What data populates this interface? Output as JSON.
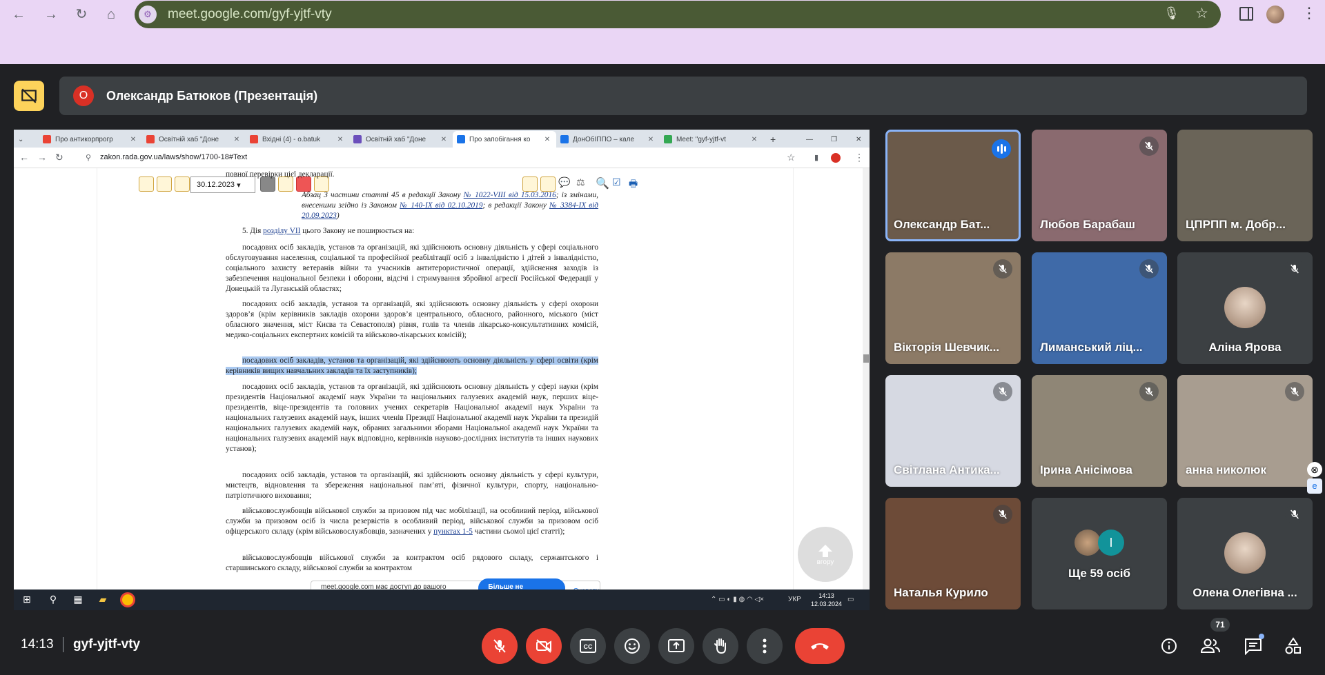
{
  "browser": {
    "url": "meet.google.com/gyf-yjtf-vty"
  },
  "meet": {
    "presenter_initial": "О",
    "presenter_title": "Олександр Батюков (Презентація)",
    "meeting_time": "14:13",
    "meeting_code": "gyf-yjtf-vty",
    "participant_count": "71"
  },
  "shared": {
    "tabs": [
      {
        "label": "Про антикорпрогр",
        "color": "#ea4335"
      },
      {
        "label": "Освітній хаб \"Доне",
        "color": "#ea4335"
      },
      {
        "label": "Вхідні (4) - o.batuk",
        "color": "#ea4335"
      },
      {
        "label": "Освітній хаб \"Доне",
        "color": "#6b4fbb"
      },
      {
        "label": "Про запобігання ко",
        "color": "#1a73e8"
      },
      {
        "label": "ДонОбІППО – кале",
        "color": "#1a73e8"
      },
      {
        "label": "Meet: \"gyf-yjtf-vt",
        "color": "#34a853"
      }
    ],
    "url": "zakon.rada.gov.ua/laws/show/1700-18#Text",
    "date_select": "30.12.2023",
    "doc": {
      "p0": "повної перевірки цієї декларації.",
      "p1a": "Абзац 3 частини статті 45 в редакції Закону ",
      "p1l1": "№ 1022-VIII від 15.03.2016",
      "p1b": "; із змінами, внесеними згідно із Законом ",
      "p1l2": "№ 140-IX від 02.10.2019",
      "p1c": "; в редакції Закону ",
      "p1l3": "№ 3384-IX від 20.09.2023",
      "p1d": ")",
      "p2a": "5. Дія ",
      "p2l": "розділу VII",
      "p2b": " цього Закону не поширюється на:",
      "p3": "посадових осіб закладів, установ та організацій, які здійснюють основну діяльність у сфері соціального обслуговування населення, соціальної та професійної реабілітації осіб з інвалідністю і дітей з інвалідністю, соціального захисту ветеранів війни та учасників антитерористичної операції, здійснення заходів із забезпечення національної безпеки і оборони, відсічі і стримування збройної агресії Російської Федерації у Донецькій та Луганській областях;",
      "p4": "посадових осіб закладів, установ та організацій, які здійснюють основну діяльність у сфері охорони здоров’я (крім керівників закладів охорони здоров’я центрального, обласного, районного, міського (міст обласного значення, міст Києва та Севастополя) рівня, голів та членів лікарсько-консультативних комісій, медико-соціальних експертних комісій та військово-лікарських комісій);",
      "p5": "посадових осіб закладів, установ та організацій, які здійснюють основну діяльність у сфері освіти (крім керівників вищих навчальних закладів та їх заступників);",
      "p6": "посадових осіб закладів, установ та організацій, які здійснюють основну діяльність у сфері науки (крім президентів Національної академії наук України та національних галузевих академій наук, перших віце-президентів, віце-президентів та головних учених секретарів Національної академії наук України та національних галузевих академій наук, інших членів Президії Національної академії наук України та президій національних галузевих академій наук, обраних загальними зборами Національної академії наук України та національних галузевих академій наук відповідно, керівників науково-дослідних інститутів та інших наукових установ);",
      "p7": "посадових осіб закладів, установ та організацій, які здійснюють основну діяльність у сфері культури, мистецтв, відновлення та збереження національної пам’яті, фізичної культури, спорту, національно-патріотичного виховання;",
      "p8a": "військовослужбовців військової служби за призовом під час мобілізації, на особливий період, військової служби за призовом осіб із числа резервістів в особливий період, військової служби за призовом осіб офіцерського складу (крім військовослужбовців, зазначених у ",
      "p8l": "пунктах 1-5",
      "p8b": " частини сьомої цієї статті);",
      "p9": "військовослужбовців військової служби за контрактом осіб рядового складу, сержантського і старшинського складу, військової служби за контрактом"
    },
    "up_label": "вгору",
    "share_msg": "meet.google.com має доступ до вашого екрана.",
    "share_stop": "Більше не ділитися",
    "share_hide": "Сховати",
    "taskbar_time": "14:13",
    "taskbar_date": "12.03.2024",
    "taskbar_lang": "УКР"
  },
  "participants": [
    {
      "name": "Олександр Бат...",
      "bg": "#6b5a4a",
      "speaking": true
    },
    {
      "name": "Любов Барабаш",
      "bg": "#8a6a6f",
      "muted": true
    },
    {
      "name": "ЦПРПП м. Добр...",
      "bg": "#6a6458",
      "muted": false
    },
    {
      "name": "Вікторія Шевчик...",
      "bg": "#8c7a66",
      "muted": true
    },
    {
      "name": "Лиманський ліц...",
      "bg": "#3f6aa8",
      "muted": true
    },
    {
      "name": "Аліна Ярова",
      "bg": "#3c4043",
      "muted": true,
      "avatar": true
    },
    {
      "name": "Світлана Антика...",
      "bg": "#d6d9e2",
      "muted": true
    },
    {
      "name": "Ірина Анісімова",
      "bg": "#8f8676",
      "muted": true
    },
    {
      "name": "анна николюк",
      "bg": "#a89d90",
      "muted": true
    },
    {
      "name": "Наталья Курило",
      "bg": "#6d4b38",
      "muted": true
    },
    {
      "name": "Ще 59 осіб",
      "bg": "#3c4043",
      "others": true,
      "other_initial": "І"
    },
    {
      "name": "Олена Олегівна ...",
      "bg": "#3c4043",
      "muted": true,
      "avatar": true
    }
  ],
  "icons": {
    "controls": [
      "mic-off-icon",
      "camera-off-icon",
      "captions-icon",
      "emoji-icon",
      "present-icon",
      "raise-hand-icon",
      "more-options-icon",
      "hangup-icon"
    ],
    "right": [
      "info-icon",
      "people-icon",
      "chat-icon",
      "activities-icon"
    ]
  }
}
